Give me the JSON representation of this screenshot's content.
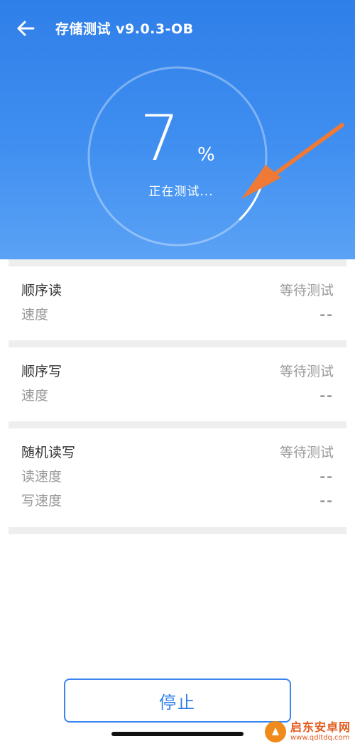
{
  "header": {
    "title": "存储测试 v9.0.3-OB",
    "progress_percent": 7,
    "progress_value": "7",
    "percent_sign": "%",
    "status": "正在测试..."
  },
  "sections": [
    {
      "name": "顺序读",
      "status": "等待测试",
      "metrics": [
        {
          "label": "速度",
          "value": "--"
        }
      ]
    },
    {
      "name": "顺序写",
      "status": "等待测试",
      "metrics": [
        {
          "label": "速度",
          "value": "--"
        }
      ]
    },
    {
      "name": "随机读写",
      "status": "等待测试",
      "metrics": [
        {
          "label": "读速度",
          "value": "--"
        },
        {
          "label": "写速度",
          "value": "--"
        }
      ]
    }
  ],
  "footer": {
    "stop_label": "停止"
  },
  "watermark": {
    "name": "启东安卓网",
    "url": "www.qdltdq.com"
  },
  "colors": {
    "header_top": "#2f7fe9",
    "header_bottom": "#5aa2f5",
    "accent": "#3a86ee",
    "annotation_arrow": "#f07a35",
    "divider": "#eeeeee"
  },
  "icons": {
    "back": "arrow-left-icon",
    "annotation": "annotation-arrow-icon"
  }
}
